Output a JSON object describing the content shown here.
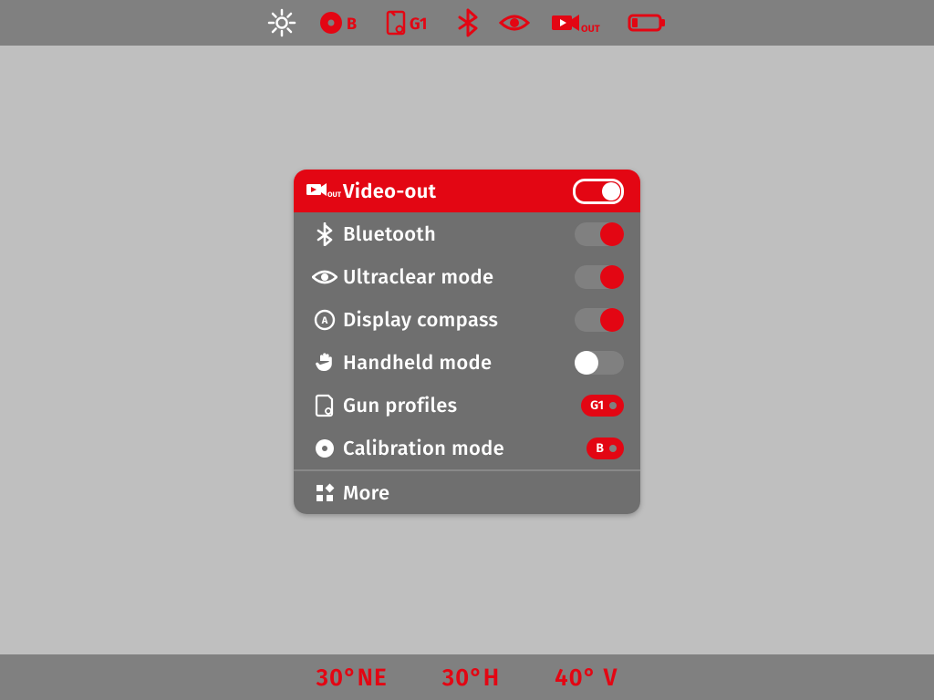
{
  "topbar": {
    "calibration_mode_badge": "B",
    "gun_profile_badge": "G1",
    "video_out_suffix": "OUT"
  },
  "menu": {
    "items": [
      {
        "key": "video-out",
        "label": "Video-out",
        "icon_suffix": "OUT",
        "selected": true,
        "control": "switch_outline",
        "on": true
      },
      {
        "key": "bluetooth",
        "label": "Bluetooth",
        "control": "switch_red",
        "on": true
      },
      {
        "key": "ultraclear",
        "label": "Ultraclear mode",
        "control": "switch_red",
        "on": true
      },
      {
        "key": "display-compass",
        "label": "Display compass",
        "control": "switch_red",
        "on": true
      },
      {
        "key": "handheld",
        "label": "Handheld mode",
        "control": "switch_off",
        "on": false
      },
      {
        "key": "gun-profiles",
        "label": "Gun profiles",
        "control": "chip",
        "chip_value": "G1"
      },
      {
        "key": "calibration",
        "label": "Calibration mode",
        "control": "chip",
        "chip_value": "B"
      },
      {
        "key": "more",
        "label": "More",
        "control": "none"
      }
    ]
  },
  "statusbar": {
    "heading": "30°NE",
    "angle_h": "30°H",
    "angle_v": "40° V"
  },
  "colors": {
    "accent": "#e30613",
    "panel": "#6f6f6f",
    "bg": "#bfbfbf",
    "bar": "#808080"
  }
}
